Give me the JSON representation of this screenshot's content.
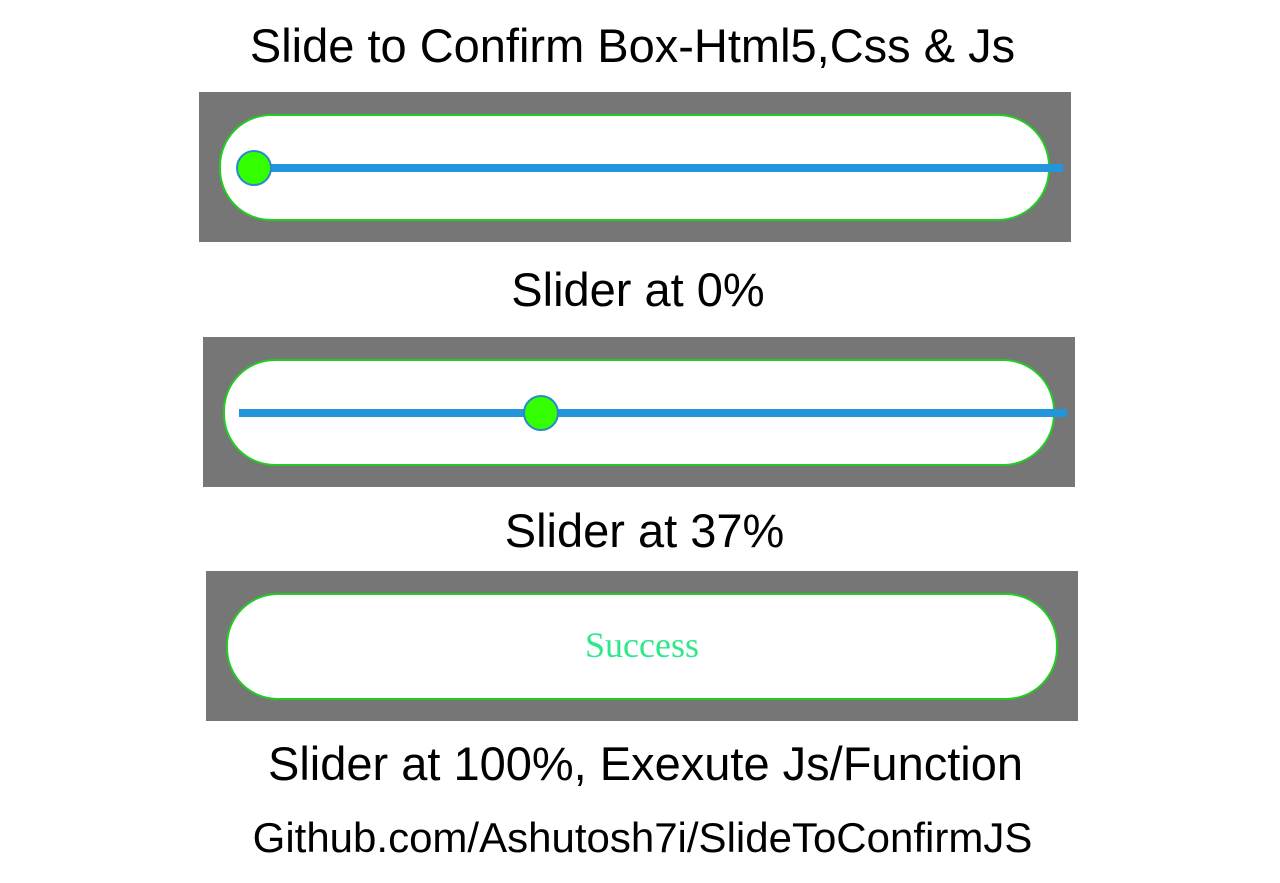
{
  "page": {
    "title": "Slide to Confirm Box-Html5,Css & Js",
    "footer_link": "Github.com/Ashutosh7i/SlideToConfirmJS"
  },
  "colors": {
    "panel_background": "#767676",
    "pill_background": "#ffffff",
    "pill_border": "#22cc22",
    "track": "#2295dd",
    "knob_fill": "#33ff00",
    "knob_border": "#2a86cf",
    "success_text": "#2ee88a"
  },
  "demos": [
    {
      "slider_progress": 0,
      "caption": "Slider at 0%"
    },
    {
      "slider_progress": 0.37,
      "caption": "Slider at 37%"
    },
    {
      "slider_progress": 1,
      "status_text": "Success",
      "caption": "Slider at 100%, Exexute Js/Function"
    }
  ]
}
